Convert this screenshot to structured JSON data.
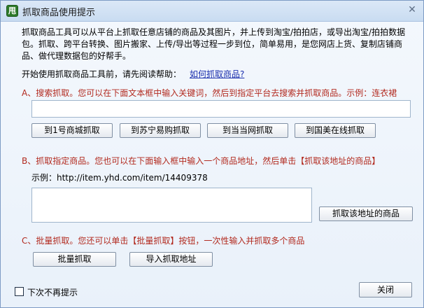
{
  "window": {
    "icon_text": "甩",
    "title": "抓取商品使用提示",
    "close_glyph": "✕"
  },
  "intro": {
    "paragraph": "抓取商品工具可以从平台上抓取任意店铺的商品及其图片，并上传到淘宝/拍拍店，或导出淘宝/拍拍数据包。抓取、跨平台转换、图片搬家、上传/导出等过程一步到位，简单易用，是您网店上货、复制店铺商品、做代理数据包的好帮手。",
    "help_prompt": "开始使用抓取商品工具前，请先阅读帮助：",
    "help_link": "如何抓取商品?"
  },
  "section_a": {
    "heading": "A、搜索抓取。您可以在下面文本框中输入关键词，然后到指定平台去搜索并抓取商品。示例：连衣裙",
    "keyword_value": "",
    "buttons": [
      "到1号商城抓取",
      "到苏宁易购抓取",
      "到当当网抓取",
      "到国美在线抓取"
    ]
  },
  "section_b": {
    "heading": "B、抓取指定商品。您也可以在下面输入框中输入一个商品地址，然后单击【抓取该地址的商品】",
    "example": "示例：http://item.yhd.com/item/14409378",
    "url_value": "",
    "grab_button": "抓取该地址的商品"
  },
  "section_c": {
    "heading": "C、批量抓取。您还可以单击【批量抓取】按钮，一次性输入并抓取多个商品",
    "batch_button": "批量抓取",
    "import_button": "导入抓取地址"
  },
  "footer": {
    "dont_show_label": "下次不再提示",
    "dont_show_checked": false,
    "close_button": "关闭"
  },
  "colors": {
    "accent_red": "#b22a1f",
    "link_blue": "#1b2fae",
    "titlebar": "#c9dcf1"
  }
}
